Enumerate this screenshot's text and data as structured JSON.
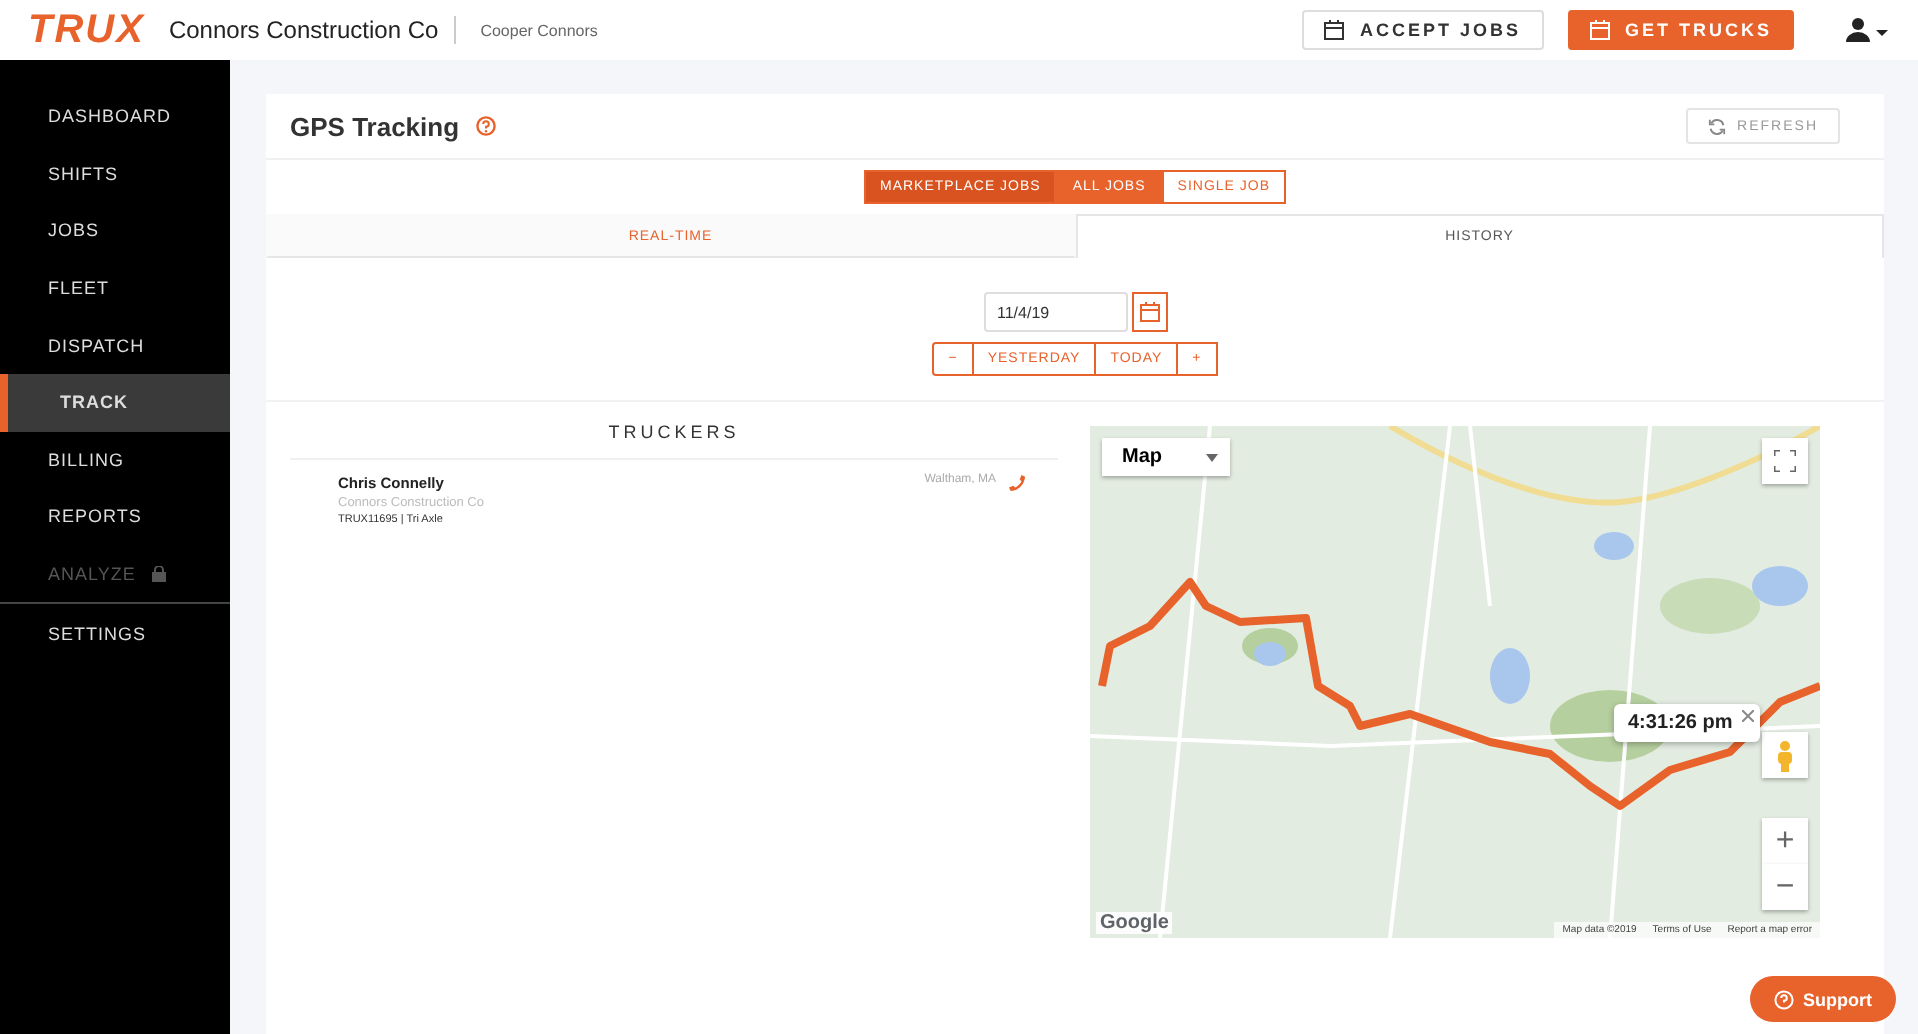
{
  "header": {
    "logo": "TRUX",
    "company": "Connors Construction Co",
    "user": "Cooper Connors",
    "buttons": [
      {
        "label": "ACCEPT JOBS",
        "kind": "outline"
      },
      {
        "label": "GET TRUCKS",
        "kind": "filled"
      }
    ]
  },
  "sidebar": {
    "items": [
      {
        "label": "DASHBOARD",
        "selected": false,
        "locked": false
      },
      {
        "label": "SHIFTS",
        "selected": false,
        "locked": false
      },
      {
        "label": "JOBS",
        "selected": false,
        "locked": false
      },
      {
        "label": "FLEET",
        "selected": false,
        "locked": false
      },
      {
        "label": "DISPATCH",
        "selected": false,
        "locked": false
      },
      {
        "label": "TRACK",
        "selected": true,
        "locked": false
      },
      {
        "label": "BILLING",
        "selected": false,
        "locked": false
      },
      {
        "label": "REPORTS",
        "selected": false,
        "locked": false
      },
      {
        "label": "ANALYZE",
        "selected": false,
        "locked": true
      },
      {
        "label": "SETTINGS",
        "selected": false,
        "locked": false
      }
    ]
  },
  "page": {
    "title": "GPS Tracking",
    "refresh": "REFRESH"
  },
  "job_filter": [
    {
      "label": "MARKETPLACE JOBS",
      "selected": true
    },
    {
      "label": "ALL JOBS",
      "selected": false
    },
    {
      "label": "SINGLE JOB",
      "selected": false
    }
  ],
  "tabs": [
    {
      "label": "REAL-TIME",
      "selected": false
    },
    {
      "label": "HISTORY",
      "selected": true
    }
  ],
  "date": {
    "value": "11/4/19",
    "buttons": [
      "−",
      "YESTERDAY",
      "TODAY",
      "+"
    ]
  },
  "truckers": {
    "title": "TRUCKERS",
    "rows": [
      {
        "name": "Chris Connelly",
        "company": "Connors Construction Co",
        "truck": "TRUX11695 | Tri Axle",
        "location": "Waltham, MA"
      }
    ]
  },
  "map": {
    "type_select": "Map",
    "popup": "4:31:26 pm",
    "logo": "Google",
    "attribution": [
      "Map data ©2019",
      "Terms of Use",
      "Report a map error"
    ],
    "zoom": [
      "+",
      "−"
    ]
  },
  "support": "Support"
}
